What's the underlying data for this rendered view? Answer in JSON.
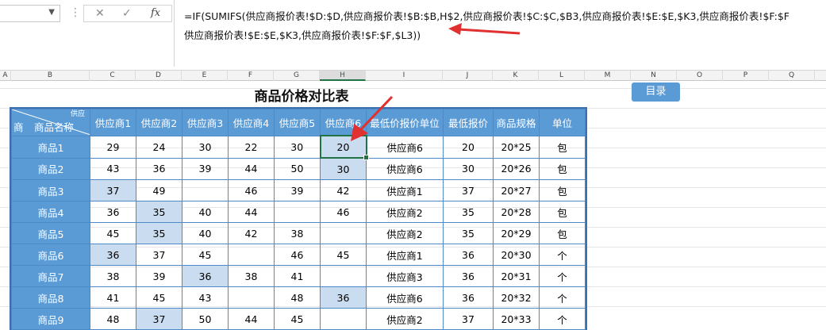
{
  "formula_bar": {
    "fx_label": "fx",
    "cancel_icon": "close-icon",
    "enter_icon": "check-icon",
    "line1": "=IF(SUMIFS(供应商报价表!$D:$D,供应商报价表!$B:$B,H$2,供应商报价表!$C:$C,$B3,供应商报价表!$E:$E,$K3,供应商报价表!$F:$F",
    "line2": "供应商报价表!$E:$E,$K3,供应商报价表!$F:$F,$L3))"
  },
  "columns": [
    "A",
    "B",
    "C",
    "D",
    "E",
    "F",
    "G",
    "H",
    "I",
    "J",
    "K",
    "L",
    "M",
    "N",
    "O",
    "P",
    "Q"
  ],
  "selected_column": "H",
  "sheet": {
    "title": "商品价格对比表",
    "toc_button": "目录",
    "header_corner": {
      "left": "商",
      "middle": "商品名称",
      "top": "供应"
    },
    "headers": [
      "供应商1",
      "供应商2",
      "供应商3",
      "供应商4",
      "供应商5",
      "供应商6",
      "最低价报价单位",
      "最低报价",
      "商品规格",
      "单位"
    ],
    "rows": [
      {
        "name": "商品1",
        "p": [
          "29",
          "24",
          "30",
          "22",
          "30",
          "20"
        ],
        "unit_supplier": "供应商6",
        "min": "20",
        "spec": "20*25",
        "unit": "包",
        "low": [
          5
        ]
      },
      {
        "name": "商品2",
        "p": [
          "43",
          "36",
          "39",
          "44",
          "50",
          "30"
        ],
        "unit_supplier": "供应商6",
        "min": "30",
        "spec": "20*26",
        "unit": "包",
        "low": [
          5
        ]
      },
      {
        "name": "商品3",
        "p": [
          "37",
          "49",
          "",
          "46",
          "39",
          "42"
        ],
        "unit_supplier": "供应商1",
        "min": "37",
        "spec": "20*27",
        "unit": "包",
        "low": [
          0
        ]
      },
      {
        "name": "商品4",
        "p": [
          "36",
          "35",
          "40",
          "44",
          "",
          "46"
        ],
        "unit_supplier": "供应商2",
        "min": "35",
        "spec": "20*28",
        "unit": "包",
        "low": [
          1
        ]
      },
      {
        "name": "商品5",
        "p": [
          "45",
          "35",
          "40",
          "42",
          "38",
          ""
        ],
        "unit_supplier": "供应商2",
        "min": "35",
        "spec": "20*29",
        "unit": "包",
        "low": [
          1
        ]
      },
      {
        "name": "商品6",
        "p": [
          "36",
          "37",
          "45",
          "",
          "46",
          "45"
        ],
        "unit_supplier": "供应商1",
        "min": "36",
        "spec": "20*30",
        "unit": "个",
        "low": [
          0
        ]
      },
      {
        "name": "商品7",
        "p": [
          "38",
          "39",
          "36",
          "38",
          "41",
          ""
        ],
        "unit_supplier": "供应商3",
        "min": "36",
        "spec": "20*31",
        "unit": "个",
        "low": [
          2
        ]
      },
      {
        "name": "商品8",
        "p": [
          "41",
          "45",
          "43",
          "",
          "48",
          "36"
        ],
        "unit_supplier": "供应商6",
        "min": "36",
        "spec": "20*32",
        "unit": "个",
        "low": [
          5
        ]
      },
      {
        "name": "商品9",
        "p": [
          "48",
          "37",
          "50",
          "44",
          "45",
          ""
        ],
        "unit_supplier": "供应商2",
        "min": "37",
        "spec": "20*33",
        "unit": "个",
        "low": [
          1
        ]
      }
    ]
  },
  "colors": {
    "header_blue": "#5b9bd5",
    "lowest_fill": "#c9dcf0",
    "arrow_red": "#e03030",
    "excel_green": "#217346"
  }
}
